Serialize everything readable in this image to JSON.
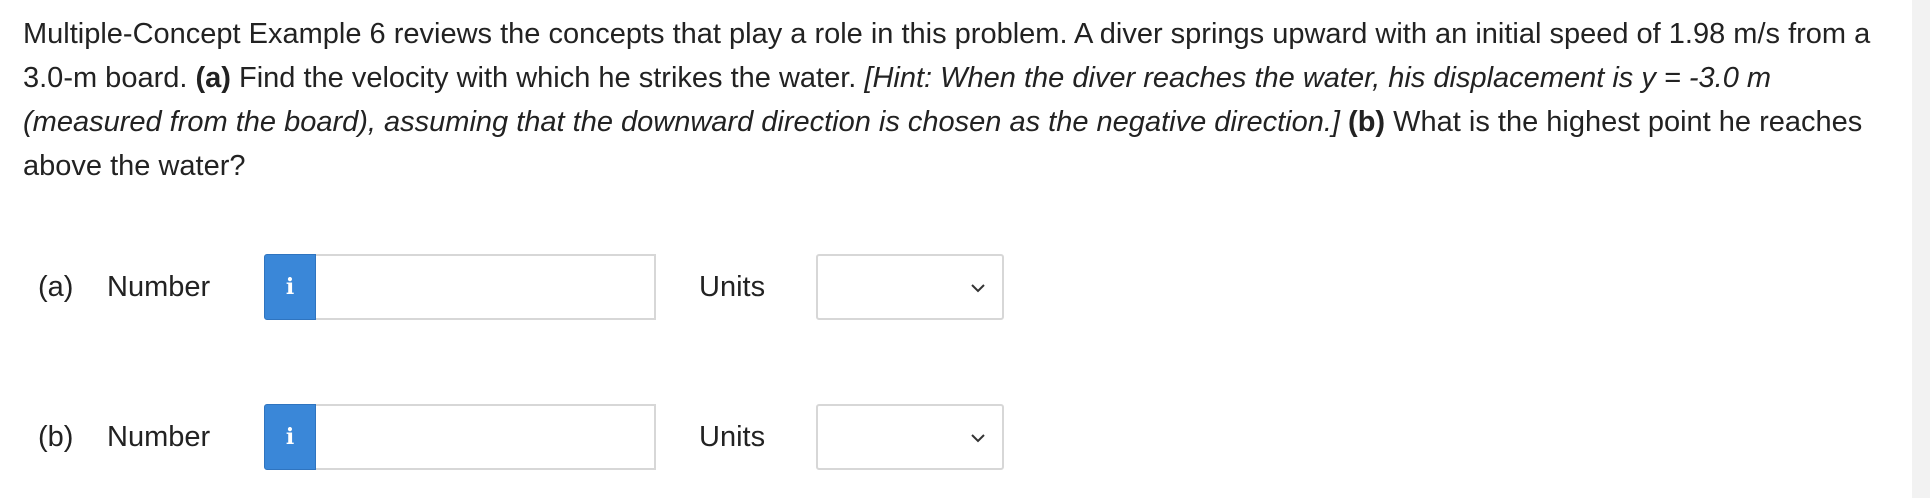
{
  "question": {
    "intro": "Multiple-Concept Example 6 reviews the concepts that play a role in this problem. A diver springs upward with an initial speed of 1.98 m/s from a 3.0-m board.",
    "part_a_marker": "(a)",
    "part_a_text": "Find the velocity with which he strikes the water.",
    "hint": "[Hint: When the diver reaches the water, his displacement is y = -3.0 m (measured from the board), assuming that the downward direction is chosen as the negative direction.]",
    "part_b_marker": "(b)",
    "part_b_text": "What is the highest point he reaches above the water?"
  },
  "answers": [
    {
      "part_label": "(a)",
      "number_label": "Number",
      "info_icon": "i",
      "number_value": "",
      "units_label": "Units",
      "units_selected": ""
    },
    {
      "part_label": "(b)",
      "number_label": "Number",
      "info_icon": "i",
      "number_value": "",
      "units_label": "Units",
      "units_selected": ""
    }
  ],
  "colors": {
    "info_button": "#3a87d8",
    "text": "#222222",
    "border": "#d7d7d7"
  }
}
